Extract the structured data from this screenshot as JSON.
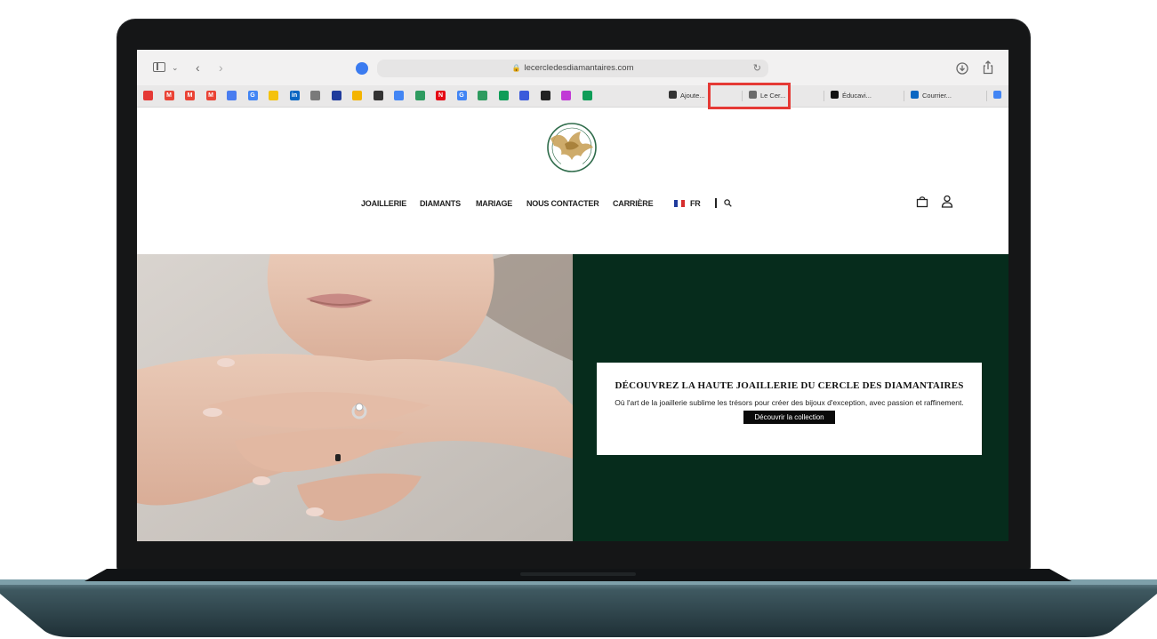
{
  "browser": {
    "url": "lecercledesdiamantaires.com",
    "bookmarks": [
      {
        "icon": "bookmark-red-icon",
        "color": "#e53935"
      },
      {
        "icon": "gmail-icon",
        "label": "M",
        "color": "#ea4335"
      },
      {
        "icon": "gmail-icon",
        "label": "M",
        "color": "#ea4335"
      },
      {
        "icon": "gmail-icon",
        "label": "M",
        "color": "#ea4335"
      },
      {
        "icon": "sparkle-icon",
        "color": "#4a7df0"
      },
      {
        "icon": "google-icon",
        "label": "G",
        "color": "#4285f4"
      },
      {
        "icon": "star-badge-icon",
        "color": "#f4c20d"
      },
      {
        "icon": "linkedin-icon",
        "label": "in",
        "color": "#0a66c2"
      },
      {
        "icon": "grey-app-icon",
        "color": "#7a7a7a"
      },
      {
        "icon": "flag-icon",
        "color": "#1f3b9c"
      },
      {
        "icon": "yellow-app-icon",
        "color": "#f4b400"
      },
      {
        "icon": "dark-app-icon",
        "color": "#333333"
      },
      {
        "icon": "pinwheel-icon",
        "color": "#4285f4"
      },
      {
        "icon": "chart-app-icon",
        "color": "#2e9b5f"
      },
      {
        "icon": "netflix-icon",
        "label": "N",
        "color": "#e50914"
      },
      {
        "icon": "google-icon",
        "label": "G",
        "color": "#4285f4"
      },
      {
        "icon": "chart-app-icon",
        "color": "#2e9b5f"
      },
      {
        "icon": "drive-icon",
        "color": "#0f9d58"
      },
      {
        "icon": "blue-circle-icon",
        "color": "#3b5bdb"
      },
      {
        "icon": "plane-icon",
        "color": "#222222"
      },
      {
        "icon": "purple-app-icon",
        "color": "#c13ad6"
      },
      {
        "icon": "sheets-icon",
        "color": "#0f9d58"
      }
    ],
    "tabs": [
      {
        "label": "Ajoute...",
        "color": "#333333"
      },
      {
        "label": "Le Cer...",
        "color": "#6b6b6b"
      },
      {
        "label": "Éducavi...",
        "color": "#111111"
      },
      {
        "label": "Courrier...",
        "color": "#0a66c2"
      },
      {
        "label": "G",
        "color": "#4285f4"
      }
    ]
  },
  "site": {
    "nav": [
      "JOAILLERIE",
      "DIAMANTS",
      "MARIAGE",
      "NOUS CONTACTER",
      "CARRIÈRE"
    ],
    "lang": "FR",
    "hero": {
      "title": "DÉCOUVREZ LA HAUTE JOAILLERIE DU CERCLE DES DIAMANTAIRES",
      "subtitle": "Où l'art de la joaillerie sublime les trésors pour créer des bijoux d'exception, avec passion et raffinement.",
      "cta": "Découvrir la collection"
    },
    "colors": {
      "hero_bg": "#062c1c",
      "logo_gold": "#c9a25a",
      "logo_green": "#2e6b4a"
    }
  }
}
